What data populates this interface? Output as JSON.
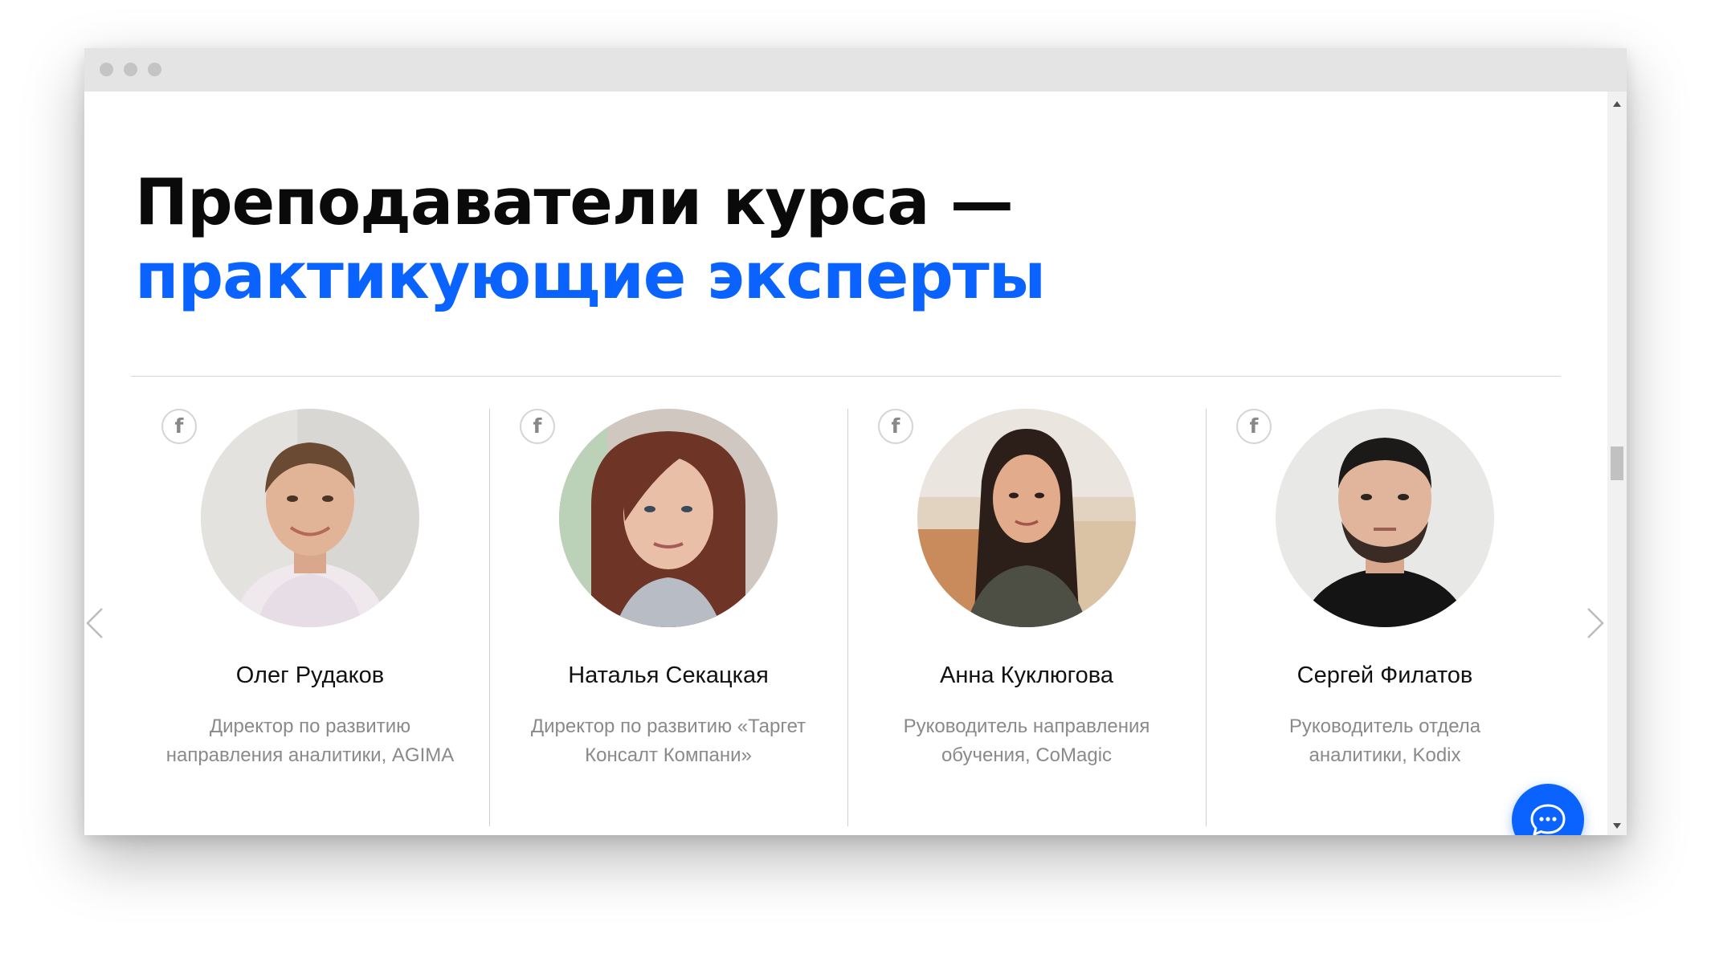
{
  "heading": {
    "line1": "Преподаватели курса —",
    "line2": "практикующие эксперты"
  },
  "colors": {
    "accent": "#0a63ff",
    "heading": "#0a0a0a",
    "muted_text": "#8a8a8a"
  },
  "social_icon_glyph": "f",
  "teachers": [
    {
      "name": "Олег Рудаков",
      "role_line1": "Директор по развитию",
      "role_line2": "направления аналитики, AGIMA",
      "social_icon": "facebook-icon"
    },
    {
      "name": "Наталья Секацкая",
      "role_line1": "Директор по развитию «Таргет",
      "role_line2": "Консалт Компани»",
      "social_icon": "facebook-icon"
    },
    {
      "name": "Анна Куклюгова",
      "role_line1": "Руководитель направления",
      "role_line2": "обучения, CoMagic",
      "social_icon": "facebook-icon"
    },
    {
      "name": "Сергей Филатов",
      "role_line1": "Руководитель отдела",
      "role_line2": "аналитики, Kodix",
      "social_icon": "facebook-icon"
    }
  ],
  "controls": {
    "prev_icon": "chevron-left-icon",
    "next_icon": "chevron-right-icon",
    "chat_icon": "chat-bubble-icon"
  }
}
